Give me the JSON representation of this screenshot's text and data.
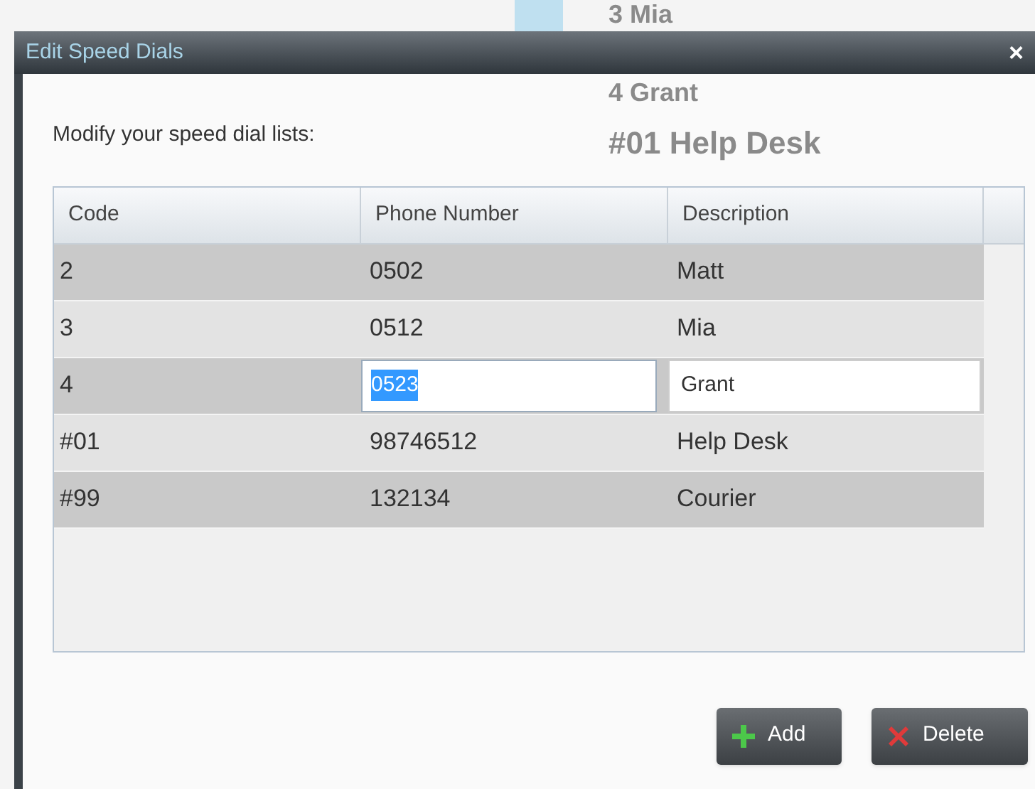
{
  "background_list": [
    {
      "code": "3",
      "name": "Mia"
    },
    {
      "code": "4",
      "name": "Grant"
    },
    {
      "code": "#01",
      "name": "Help Desk"
    }
  ],
  "dialog": {
    "title": "Edit Speed Dials",
    "close": "×",
    "instruction": "Modify your speed dial lists:"
  },
  "table": {
    "columns": [
      "Code",
      "Phone Number",
      "Description"
    ],
    "rows": [
      {
        "code": "2",
        "phone": "0502",
        "description": "Matt",
        "editing": false
      },
      {
        "code": "3",
        "phone": "0512",
        "description": "Mia",
        "editing": false
      },
      {
        "code": "4",
        "phone": "0523",
        "description": "Grant",
        "editing": true
      },
      {
        "code": "#01",
        "phone": "98746512",
        "description": "Help Desk",
        "editing": false
      },
      {
        "code": "#99",
        "phone": "132134",
        "description": "Courier",
        "editing": false
      }
    ]
  },
  "buttons": [
    {
      "kind": "add",
      "label": "Add"
    },
    {
      "kind": "delete",
      "label": "Delete"
    }
  ]
}
